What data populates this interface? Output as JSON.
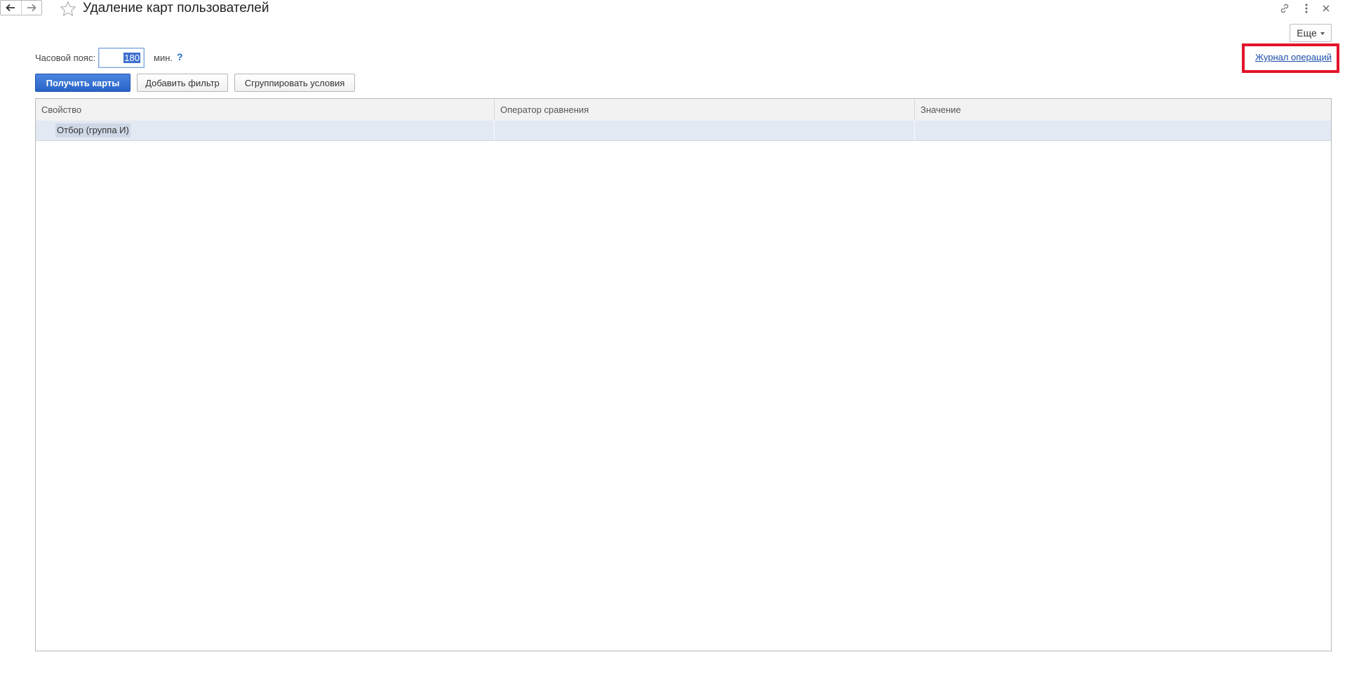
{
  "window": {
    "title": "Удаление карт пользователей",
    "more_label": "Еще"
  },
  "timezone": {
    "label": "Часовой пояс:",
    "value": "180",
    "unit": "мин.",
    "help": "?"
  },
  "journal_link": "Журнал операций",
  "buttons": {
    "get_cards": "Получить карты",
    "add_filter": "Добавить фильтр",
    "group_conditions": "Сгруппировать условия"
  },
  "table": {
    "columns": [
      "Свойство",
      "Оператор сравнения",
      "Значение"
    ],
    "rows": [
      {
        "property": "Отбор (группа И)",
        "operator": "",
        "value": ""
      }
    ]
  },
  "icons": {
    "back": "arrow-left-icon",
    "forward": "arrow-right-icon",
    "favorite": "star-icon",
    "link": "link-icon",
    "menu": "vertical-dots-icon",
    "close": "close-icon"
  },
  "colors": {
    "primary_button": "#2a63c7",
    "link": "#1a4ea8",
    "highlight_box": "#e3142b",
    "selected_row": "#e3e9f3"
  }
}
